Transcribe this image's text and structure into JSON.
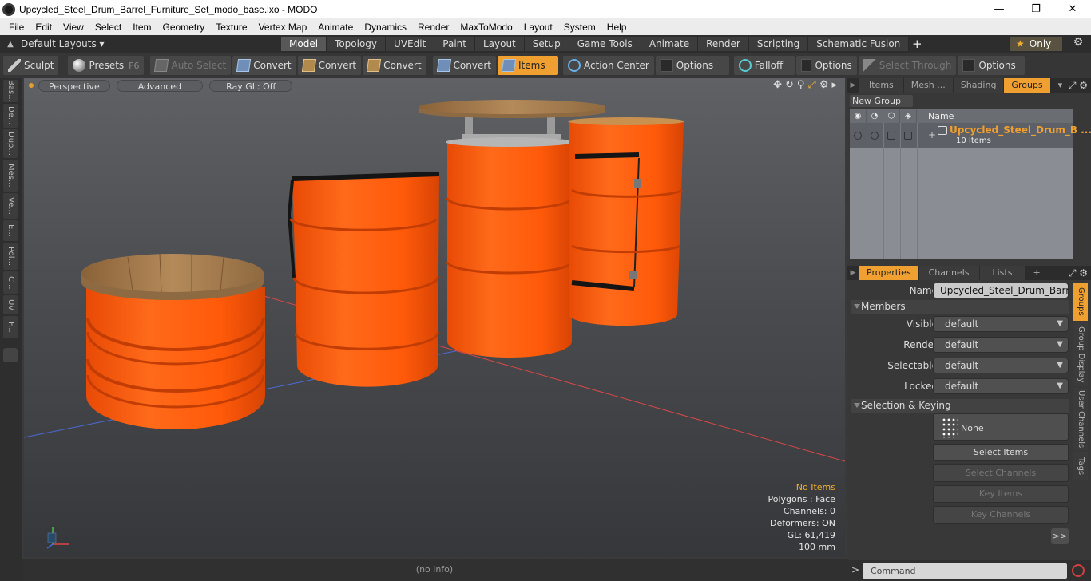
{
  "window": {
    "title": "Upcycled_Steel_Drum_Barrel_Furniture_Set_modo_base.lxo - MODO",
    "minimize": "—",
    "maximize": "❐",
    "close": "✕"
  },
  "menu": [
    "File",
    "Edit",
    "View",
    "Select",
    "Item",
    "Geometry",
    "Texture",
    "Vertex Map",
    "Animate",
    "Dynamics",
    "Render",
    "MaxToModo",
    "Layout",
    "System",
    "Help"
  ],
  "layout_bar": {
    "layouts_label": "Default Layouts ▾",
    "tabs": [
      "Model",
      "Topology",
      "UVEdit",
      "Paint",
      "Layout",
      "Setup",
      "Game Tools",
      "Animate",
      "Render",
      "Scripting",
      "Schematic Fusion"
    ],
    "active_tab": "Model",
    "plus": "+",
    "only_label": "Only",
    "only_star": "★",
    "gear": "⚙"
  },
  "toolbar": {
    "sculpt": "Sculpt",
    "presets": "Presets",
    "presets_key": "F6",
    "auto_select": "Auto Select",
    "convert1": "Convert",
    "convert2": "Convert",
    "convert3": "Convert",
    "convert4": "Convert",
    "items": "Items",
    "action_center": "Action Center",
    "options1": "Options",
    "falloff": "Falloff",
    "options2": "Options",
    "select_through": "Select Through",
    "options3": "Options"
  },
  "left_tabs": [
    "Bas...",
    "De...",
    "Dup...",
    "Mes...",
    "Ve...",
    "E...",
    "Pol...",
    "C...",
    "UV",
    "F..."
  ],
  "viewport": {
    "perspective": "Perspective",
    "advanced": "Advanced",
    "raygl": "Ray GL: Off",
    "hud": {
      "selection": "No Items",
      "polygons": "Polygons : Face",
      "channels": "Channels: 0",
      "deformers": "Deformers: ON",
      "gl": "GL: 61,419",
      "scale": "100 mm"
    },
    "status": "(no info)"
  },
  "groups_panel": {
    "tabs": [
      "Items",
      "Mesh ...",
      "Shading",
      "Groups"
    ],
    "active_tab": "Groups",
    "new_group": "New Group",
    "name_header": "Name",
    "group_name": "Upcycled_Steel_Drum_B ...",
    "group_count": "10 Items",
    "plus": "+"
  },
  "properties_panel": {
    "tabs": [
      "Properties",
      "Channels",
      "Lists"
    ],
    "active_tab": "Properties",
    "plus": "+",
    "name_label": "Name",
    "name_value": "Upcycled_Steel_Drum_Barrel_Furniture_Set",
    "members_section": "Members",
    "visible_label": "Visible",
    "visible_value": "default",
    "render_label": "Render",
    "render_value": "default",
    "selectable_label": "Selectable",
    "selectable_value": "default",
    "locked_label": "Locked",
    "locked_value": "default",
    "keying_section": "Selection & Keying",
    "none_label": "None",
    "select_items": "Select Items",
    "select_channels": "Select Channels",
    "key_items": "Key Items",
    "key_channels": "Key Channels",
    "expand": ">>"
  },
  "right_vtabs": [
    "Groups",
    "Group Display",
    "User Channels",
    "Tags"
  ],
  "command": {
    "placeholder": "Command",
    "chevron": ">"
  },
  "colors": {
    "accent": "#f0a030",
    "barrel": "#ff5a0a",
    "wood": "#a67c4e"
  }
}
